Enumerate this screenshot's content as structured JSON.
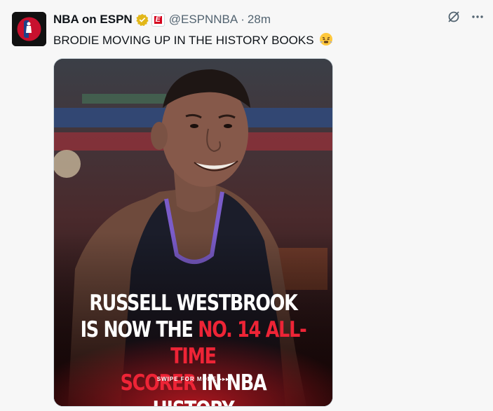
{
  "account": {
    "display_name": "NBA on ESPN",
    "handle": "@ESPNNBA",
    "separator": "·",
    "time": "28m",
    "avatar_text": "NBA ESPN",
    "affiliate_badge_letter": "E"
  },
  "tweet": {
    "text": "BRODIE MOVING UP IN THE HISTORY BOOKS",
    "emoji": "huffing-face-emoji"
  },
  "media": {
    "headline_line1": "RUSSELL WESTBROOK",
    "headline_line2_white": "IS NOW THE ",
    "headline_line2_red": "NO. 14 ALL-TIME",
    "headline_line3_red": "SCORER",
    "headline_line3_white": " IN NBA HISTORY",
    "swipe": "SWIPE FOR MORE ▸▸▸"
  },
  "colors": {
    "background": "#f7f7f7",
    "accent_red": "#ee2436",
    "verified_gold": "#e2b719",
    "muted": "#536471"
  }
}
